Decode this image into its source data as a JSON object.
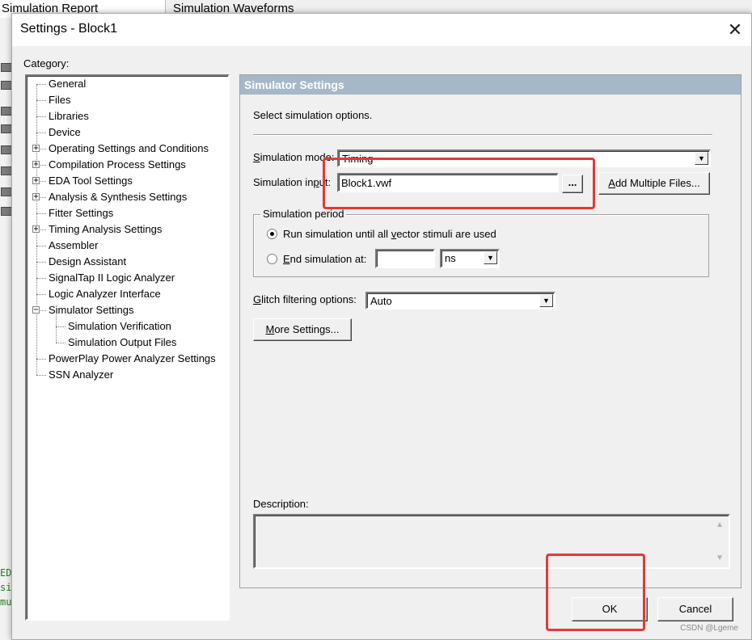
{
  "background": {
    "tab_report": "Simulation Report",
    "tab_waveforms": "Simulation Waveforms",
    "console_lines": [
      "ED",
      "si",
      "mu"
    ]
  },
  "dialog": {
    "title": "Settings - Block1",
    "close_glyph": "✕",
    "category_label": "Category:",
    "tree": [
      {
        "label": "General",
        "level": 0,
        "expander": ""
      },
      {
        "label": "Files",
        "level": 0,
        "expander": ""
      },
      {
        "label": "Libraries",
        "level": 0,
        "expander": ""
      },
      {
        "label": "Device",
        "level": 0,
        "expander": ""
      },
      {
        "label": "Operating Settings and Conditions",
        "level": 0,
        "expander": "+"
      },
      {
        "label": "Compilation Process Settings",
        "level": 0,
        "expander": "+"
      },
      {
        "label": "EDA Tool Settings",
        "level": 0,
        "expander": "+"
      },
      {
        "label": "Analysis & Synthesis Settings",
        "level": 0,
        "expander": "+"
      },
      {
        "label": "Fitter Settings",
        "level": 0,
        "expander": ""
      },
      {
        "label": "Timing Analysis Settings",
        "level": 0,
        "expander": "+"
      },
      {
        "label": "Assembler",
        "level": 0,
        "expander": ""
      },
      {
        "label": "Design Assistant",
        "level": 0,
        "expander": ""
      },
      {
        "label": "SignalTap II Logic Analyzer",
        "level": 0,
        "expander": ""
      },
      {
        "label": "Logic Analyzer Interface",
        "level": 0,
        "expander": ""
      },
      {
        "label": "Simulator Settings",
        "level": 0,
        "expander": "−"
      },
      {
        "label": "Simulation Verification",
        "level": 1,
        "expander": ""
      },
      {
        "label": "Simulation Output Files",
        "level": 1,
        "expander": ""
      },
      {
        "label": "PowerPlay Power Analyzer Settings",
        "level": 0,
        "expander": ""
      },
      {
        "label": "SSN Analyzer",
        "level": 0,
        "expander": ""
      }
    ],
    "panel": {
      "header": "Simulator Settings",
      "intro": "Select simulation options.",
      "mode_label_first": "S",
      "mode_label_rest": "imulation mode:",
      "mode_value": "Timing",
      "input_label_a": "Simulation in",
      "input_label_u": "p",
      "input_label_b": "ut:",
      "input_value": "Block1.vwf",
      "browse_label": "...",
      "add_files_first": "A",
      "add_files_rest": "dd Multiple Files...",
      "period_group_title": "Simulation period",
      "run_label_a": "Run simulation until all ",
      "run_label_u": "v",
      "run_label_b": "ector stimuli are used",
      "end_label_first": "E",
      "end_label_rest": "nd simulation at:",
      "end_value": "",
      "end_unit": "ns",
      "glitch_label_first": "G",
      "glitch_label_rest": "litch filtering options:",
      "glitch_value": "Auto",
      "more_settings_first": "M",
      "more_settings_rest": "ore Settings...",
      "description_label": "Description:",
      "description_text": ""
    },
    "ok_label": "OK",
    "cancel_label": "Cancel"
  },
  "watermark": "CSDN @Lgeme",
  "colors": {
    "panel_header_bg": "#a6b8c8",
    "highlight": "#e53935"
  }
}
